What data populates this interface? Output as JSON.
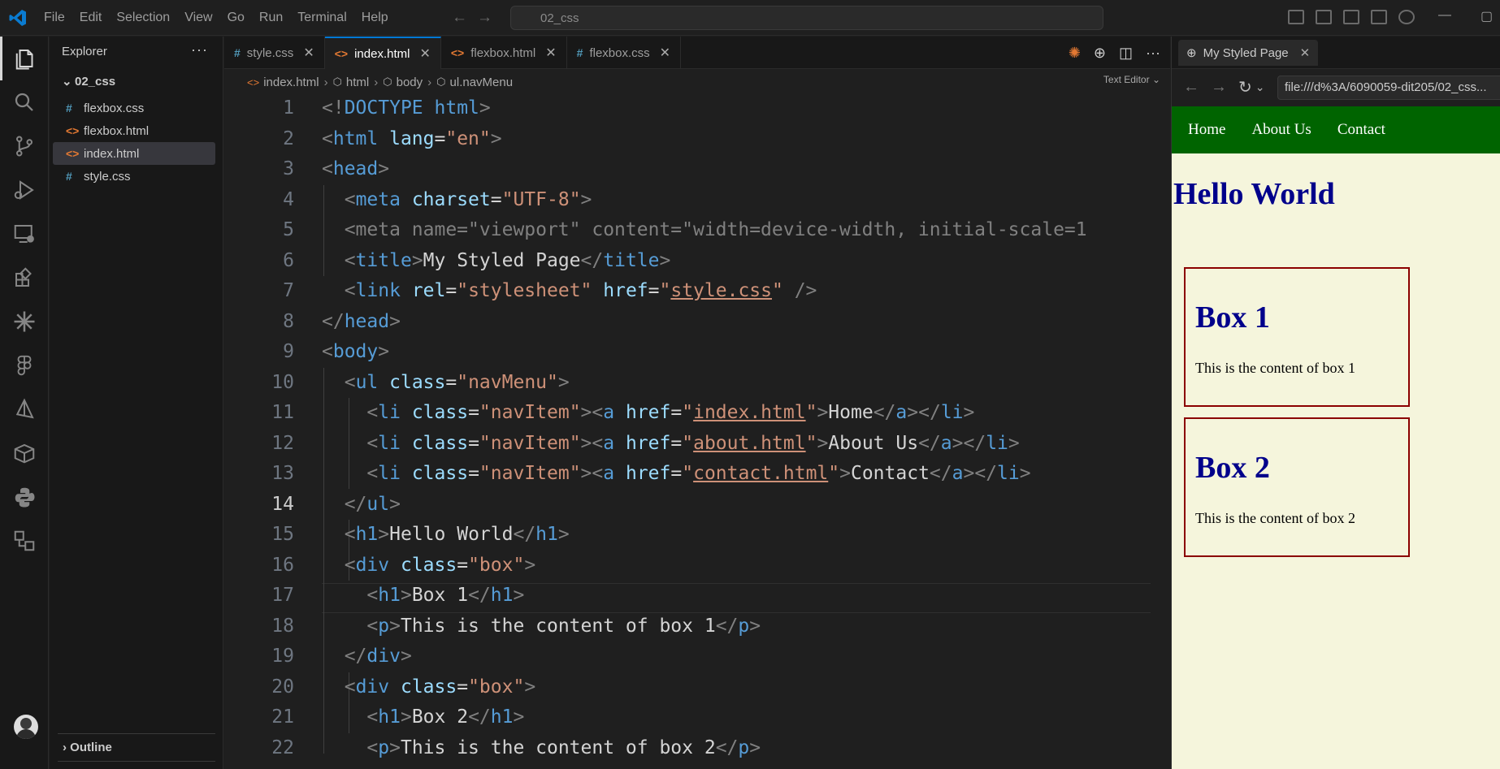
{
  "menu": {
    "items": [
      "File",
      "Edit",
      "Selection",
      "View",
      "Go",
      "Run",
      "Terminal",
      "Help"
    ]
  },
  "command_center": {
    "text": "02_css"
  },
  "explorer": {
    "title": "Explorer",
    "folder": "02_css",
    "files": [
      {
        "name": "flexbox.css",
        "icon": "css"
      },
      {
        "name": "flexbox.html",
        "icon": "html"
      },
      {
        "name": "index.html",
        "icon": "html"
      },
      {
        "name": "style.css",
        "icon": "css"
      }
    ],
    "outline": "Outline"
  },
  "tabs": [
    {
      "label": "style.css",
      "icon": "css"
    },
    {
      "label": "index.html",
      "icon": "html"
    },
    {
      "label": "flexbox.html",
      "icon": "html"
    },
    {
      "label": "flexbox.css",
      "icon": "css"
    }
  ],
  "breadcrumb": [
    "index.html",
    "html",
    "body",
    "ul.navMenu"
  ],
  "editor_mode": "Text Editor",
  "current_line": 14,
  "code_lines": [
    "<!DOCTYPE html>",
    "<html lang=\"en\">",
    "<head>",
    "  <meta charset=\"UTF-8\">",
    "  <meta name=\"viewport\" content=\"width=device-width, initial-scale=1",
    "  <title>My Styled Page</title>",
    "  <link rel=\"stylesheet\" href=\"style.css\" />",
    "</head>",
    "<body>",
    "  <ul class=\"navMenu\">",
    "    <li class=\"navItem\"><a href=\"index.html\">Home</a></li>",
    "    <li class=\"navItem\"><a href=\"about.html\">About Us</a></li>",
    "    <li class=\"navItem\"><a href=\"contact.html\">Contact</a></li>",
    "  </ul>",
    "  <h1>Hello World</h1>",
    "  <div class=\"box\">",
    "    <h1>Box 1</h1>",
    "    <p>This is the content of box 1</p>",
    "  </div>",
    "  <div class=\"box\">",
    "    <h1>Box 2</h1>",
    "    <p>This is the content of box 2</p>"
  ],
  "preview": {
    "tab_title": "My Styled Page",
    "url": "file:///d%3A/6090059-dit205/02_css...",
    "nav_links": [
      "Home",
      "About Us",
      "Contact"
    ],
    "heading": "Hello World",
    "boxes": [
      {
        "title": "Box 1",
        "text": "This is the content of box 1"
      },
      {
        "title": "Box 2",
        "text": "This is the content of box 2"
      }
    ]
  },
  "colors": {
    "accent": "#0078d4",
    "nav_green": "#006400",
    "page_bg": "#f5f5dc",
    "heading": "#00008b",
    "box_border": "#8b0000"
  }
}
